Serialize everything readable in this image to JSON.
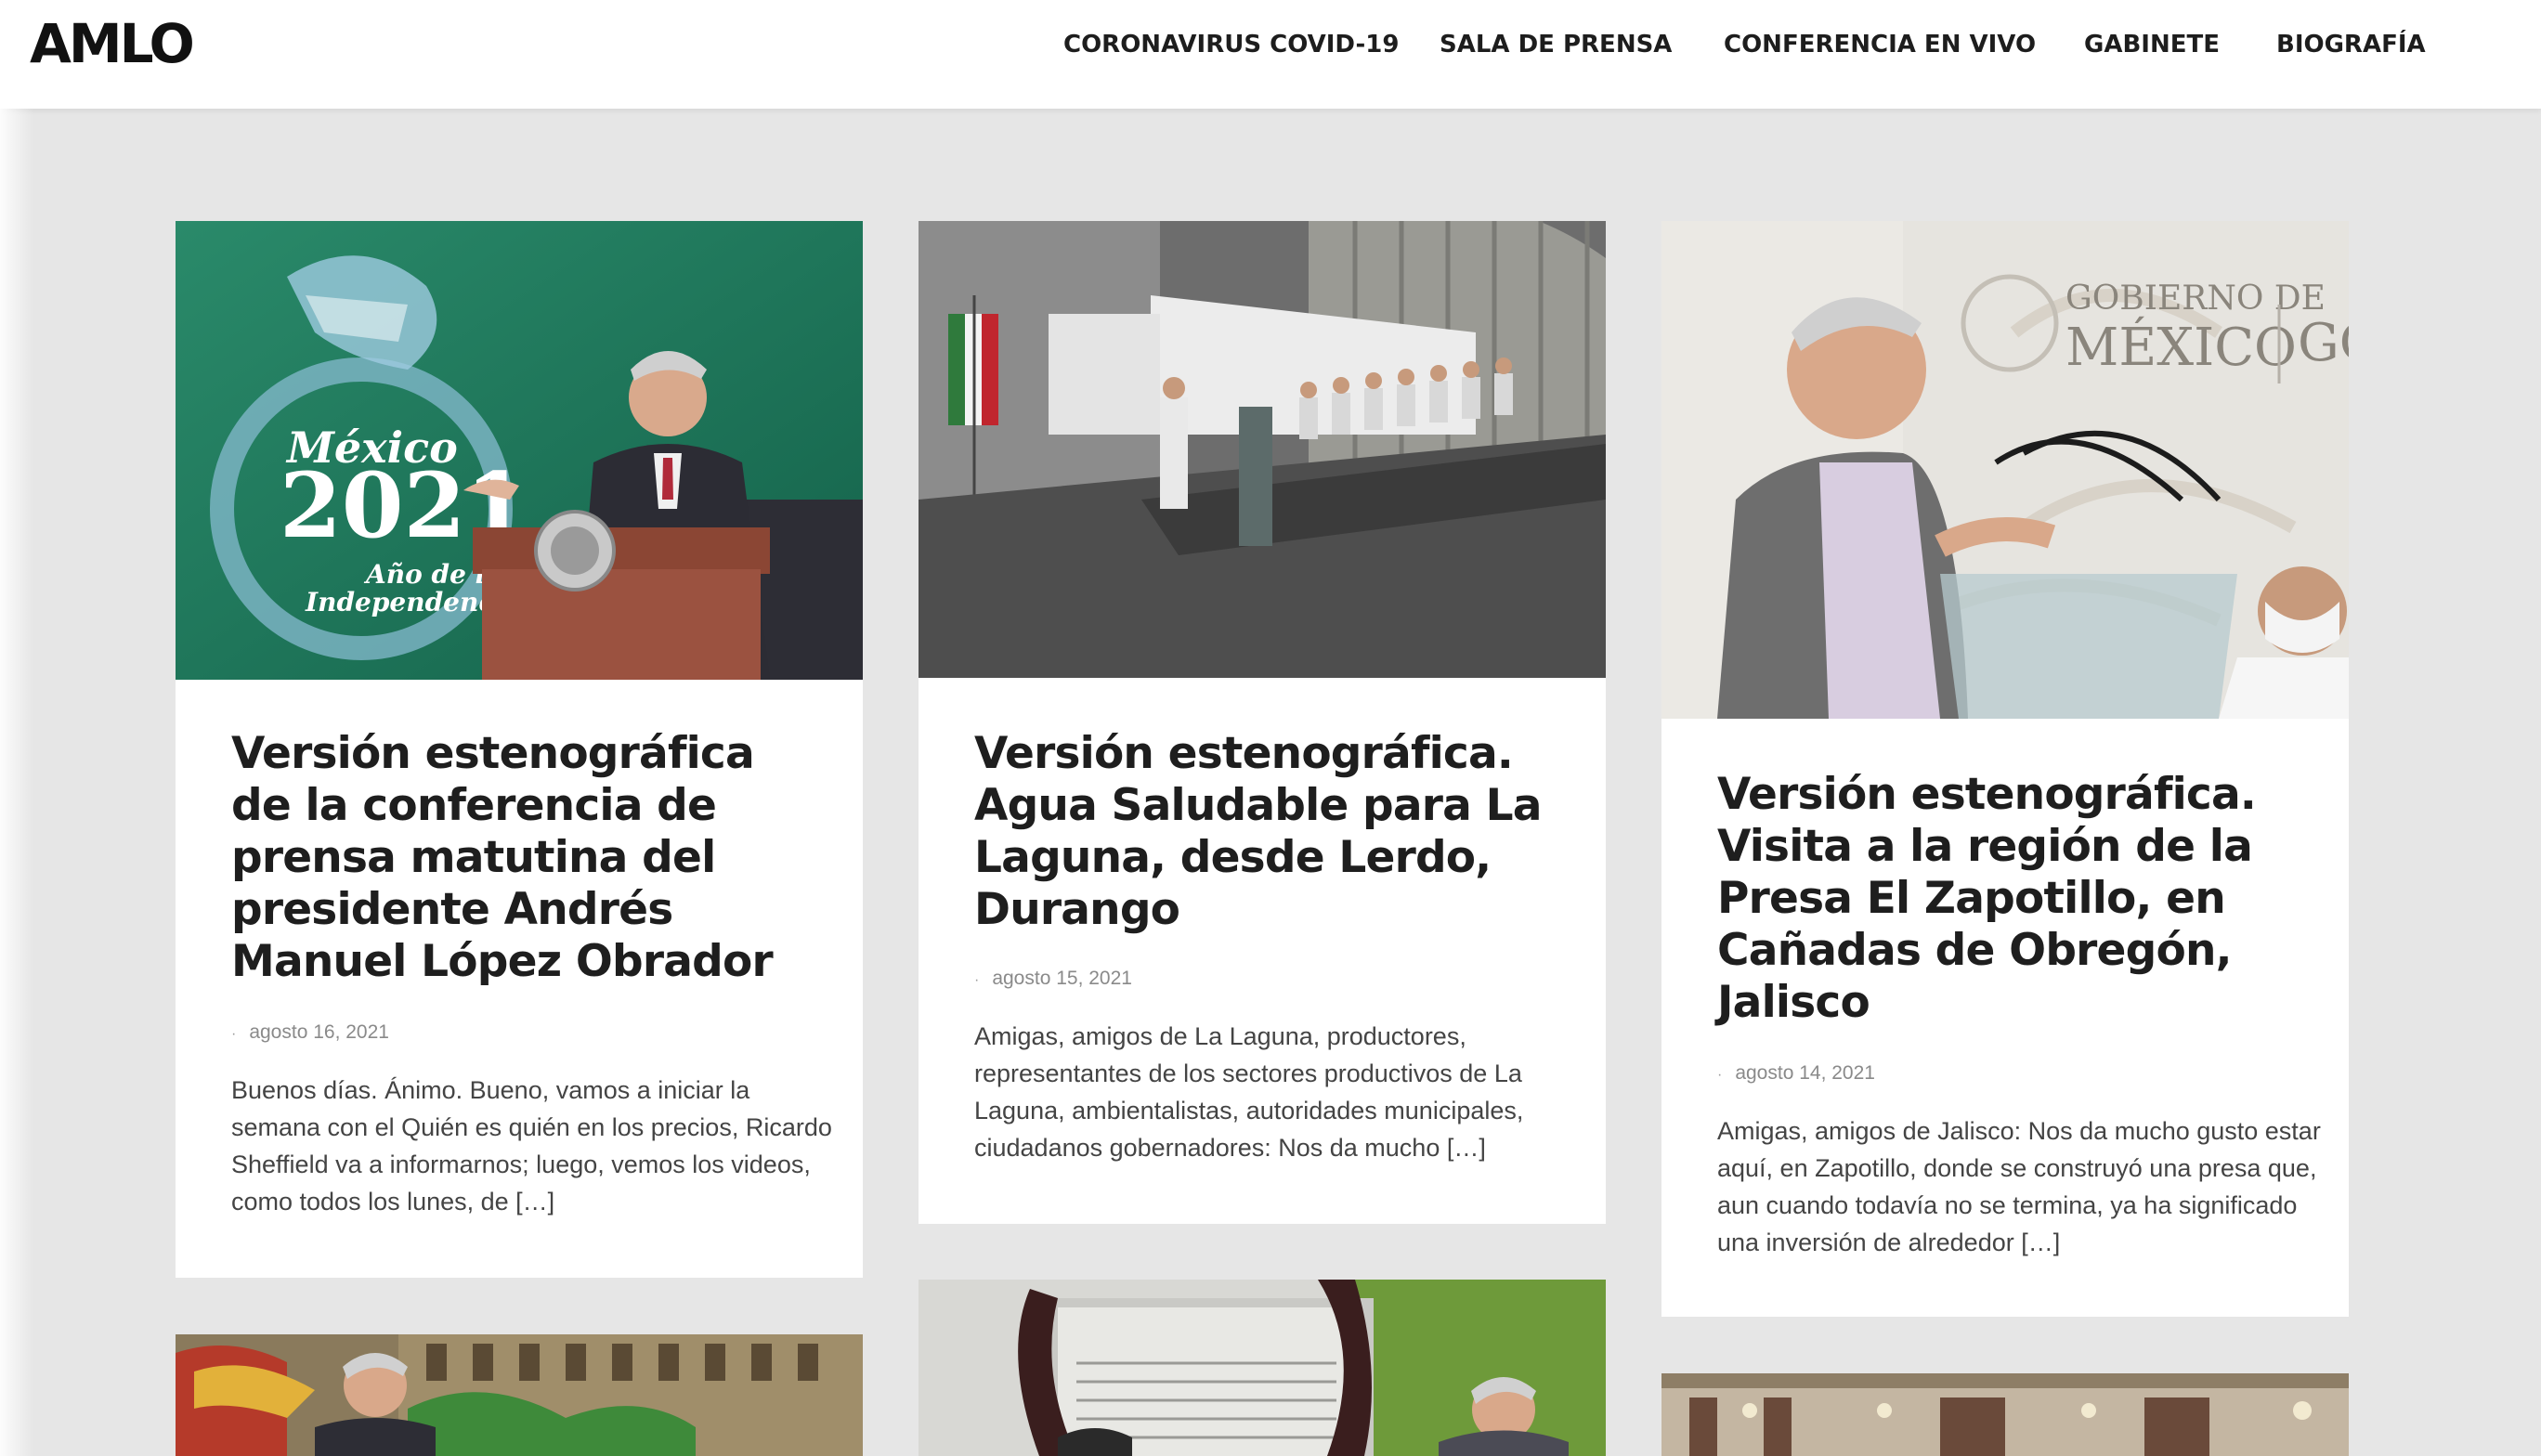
{
  "site": {
    "logo": "AMLO"
  },
  "nav": [
    {
      "label": "CORONAVIRUS COVID-19"
    },
    {
      "label": "SALA DE PRENSA"
    },
    {
      "label": "CONFERENCIA EN VIVO"
    },
    {
      "label": "GABINETE"
    },
    {
      "label": "BIOGRAFÍA"
    }
  ],
  "posts": [
    {
      "title": "Versión estenográfica de la conferencia de prensa matutina del presidente Andrés Manuel López Obrador",
      "date": "agosto 16, 2021",
      "excerpt": "Buenos días. Ánimo. Bueno, vamos a iniciar la semana con el Quién es quién en los precios, Ricardo Sheffield va a informarnos; luego, vemos los videos, como todos los lunes, de […]",
      "image_text": {
        "line1": "México",
        "line2": "2021",
        "line3": "Año de la",
        "line4": "Independencia"
      }
    },
    {
      "title": "Versión estenográfica. Agua Saludable para La Laguna, desde Lerdo, Durango",
      "date": "agosto 15, 2021",
      "excerpt": "Amigas, amigos de La Laguna, productores, representantes de los sectores productivos de La Laguna, ambientalistas, autoridades municipales, ciudadanos gobernadores: Nos da mucho […]"
    },
    {
      "title": "Versión estenográfica. Visita a la región de la Presa El Zapotillo, en Cañadas de Obregón, Jalisco",
      "date": "agosto 14, 2021",
      "excerpt": "Amigas, amigos de Jalisco: Nos da mucho gusto estar aquí, en Zapotillo, donde se construyó una presa que, aun cuando todavía no se termina, ya ha significado una inversión de alrededor […]",
      "image_text": {
        "gov1": "GOBIERNO DE",
        "gov2": "MÉXICO",
        "gov3": "GO"
      }
    }
  ],
  "meta": {
    "dot": "·"
  }
}
